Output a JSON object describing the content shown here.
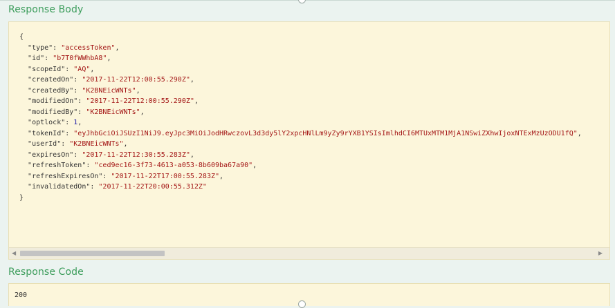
{
  "response_body": {
    "title": "Response Body",
    "open_brace": "{",
    "close_brace": "}",
    "fields": [
      {
        "key": "\"type\"",
        "value": "\"accessToken\"",
        "type": "string"
      },
      {
        "key": "\"id\"",
        "value": "\"b7T0fWWhbA8\"",
        "type": "string"
      },
      {
        "key": "\"scopeId\"",
        "value": "\"AQ\"",
        "type": "string"
      },
      {
        "key": "\"createdOn\"",
        "value": "\"2017-11-22T12:00:55.290Z\"",
        "type": "string"
      },
      {
        "key": "\"createdBy\"",
        "value": "\"K2BNEicWNTs\"",
        "type": "string"
      },
      {
        "key": "\"modifiedOn\"",
        "value": "\"2017-11-22T12:00:55.290Z\"",
        "type": "string"
      },
      {
        "key": "\"modifiedBy\"",
        "value": "\"K2BNEicWNTs\"",
        "type": "string"
      },
      {
        "key": "\"optlock\"",
        "value": "1",
        "type": "number"
      },
      {
        "key": "\"tokenId\"",
        "value": "\"eyJhbGciOiJSUzI1NiJ9.eyJpc3MiOiJodHRwczovL3d3dy5lY2xpcHNlLm9yZy9rYXB1YSIsImlhdCI6MTUxMTM1MjA1NSwiZXhwIjoxNTExMzUzODU1fQ\"",
        "type": "string"
      },
      {
        "key": "\"userId\"",
        "value": "\"K2BNEicWNTs\"",
        "type": "string"
      },
      {
        "key": "\"expiresOn\"",
        "value": "\"2017-11-22T12:30:55.283Z\"",
        "type": "string"
      },
      {
        "key": "\"refreshToken\"",
        "value": "\"ced9ec16-3f73-4613-a053-8b609ba67a90\"",
        "type": "string"
      },
      {
        "key": "\"refreshExpiresOn\"",
        "value": "\"2017-11-22T17:00:55.283Z\"",
        "type": "string"
      },
      {
        "key": "\"invalidatedOn\"",
        "value": "\"2017-11-22T20:00:55.312Z\"",
        "type": "string"
      }
    ],
    "scrollbar": {
      "left_arrow": "◀",
      "right_arrow": "▶"
    }
  },
  "response_code": {
    "title": "Response Code",
    "value": "200"
  },
  "colors": {
    "section_title": "#3d9d5c",
    "panel_bg": "#fcf6db",
    "string_value": "#a31515",
    "number_value": "#1a1aa6"
  }
}
